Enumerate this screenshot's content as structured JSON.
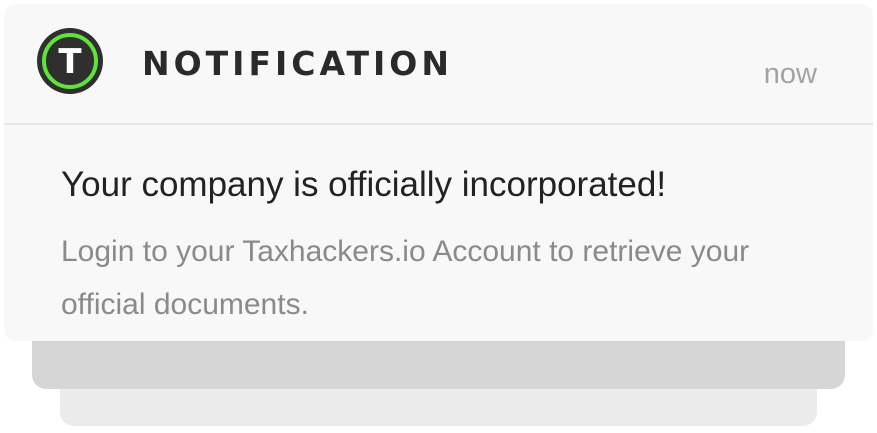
{
  "notification": {
    "app_name": "NOTIFICATION",
    "logo_letter": "T",
    "timestamp": "now",
    "title": "Your company is officially incorporated!",
    "body": "Login to your Taxhackers.io Account to retrieve your official documents."
  },
  "colors": {
    "logo_ring": "#5fe23a",
    "logo_fill": "#2f2f2f",
    "card_background": "#f8f8f8",
    "stack_mid": "#d6d6d6",
    "stack_back": "#ebebeb"
  },
  "icons": {
    "logo": "taxhackers-logo-icon"
  }
}
